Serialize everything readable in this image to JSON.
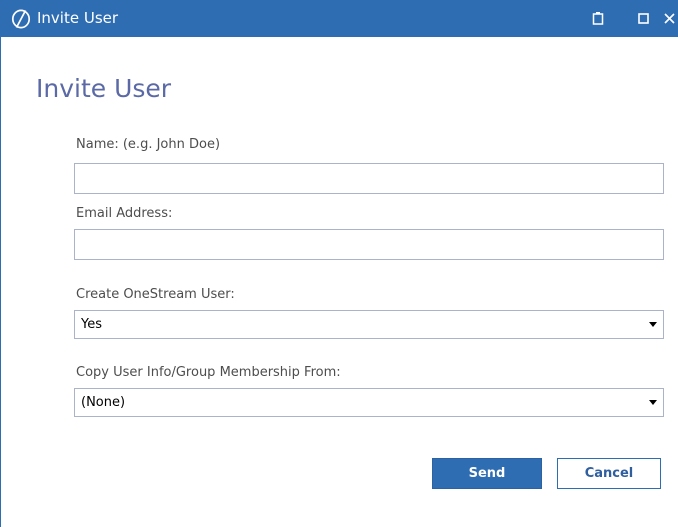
{
  "window": {
    "title": "Invite User",
    "icons": {
      "logo": "onestream-logo-icon",
      "restore": "restore-icon",
      "maximize": "maximize-icon",
      "close": "close-icon"
    },
    "colors": {
      "titlebar": "#2f6db3",
      "heading": "#5b6aa6",
      "send_button": "#2f6db3"
    }
  },
  "dialog": {
    "heading": "Invite User",
    "name": {
      "label": "Name: (e.g. John Doe)",
      "value": "",
      "placeholder": ""
    },
    "email": {
      "label": "Email Address:",
      "value": "",
      "placeholder": ""
    },
    "create_user": {
      "label": "Create OneStream User:",
      "selected": "Yes"
    },
    "copy_from": {
      "label": "Copy User Info/Group Membership From:",
      "selected": "(None)"
    },
    "buttons": {
      "send": "Send",
      "cancel": "Cancel"
    }
  }
}
